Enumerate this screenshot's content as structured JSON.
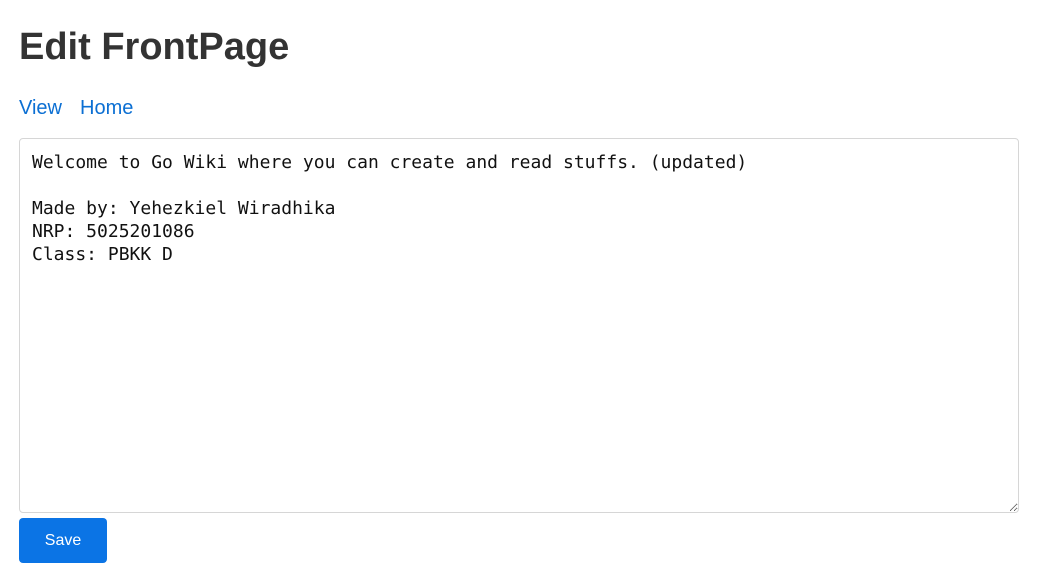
{
  "page": {
    "title": "Edit FrontPage"
  },
  "nav": {
    "view_label": "View",
    "home_label": "Home"
  },
  "editor": {
    "content": "Welcome to Go Wiki where you can create and read stuffs. (updated)\n\nMade by: Yehezkiel Wiradhika\nNRP: 5025201086\nClass: PBKK D"
  },
  "form": {
    "save_label": "Save"
  },
  "colors": {
    "link": "#0b6fd3",
    "button": "#0b74e5",
    "heading": "#333333"
  }
}
